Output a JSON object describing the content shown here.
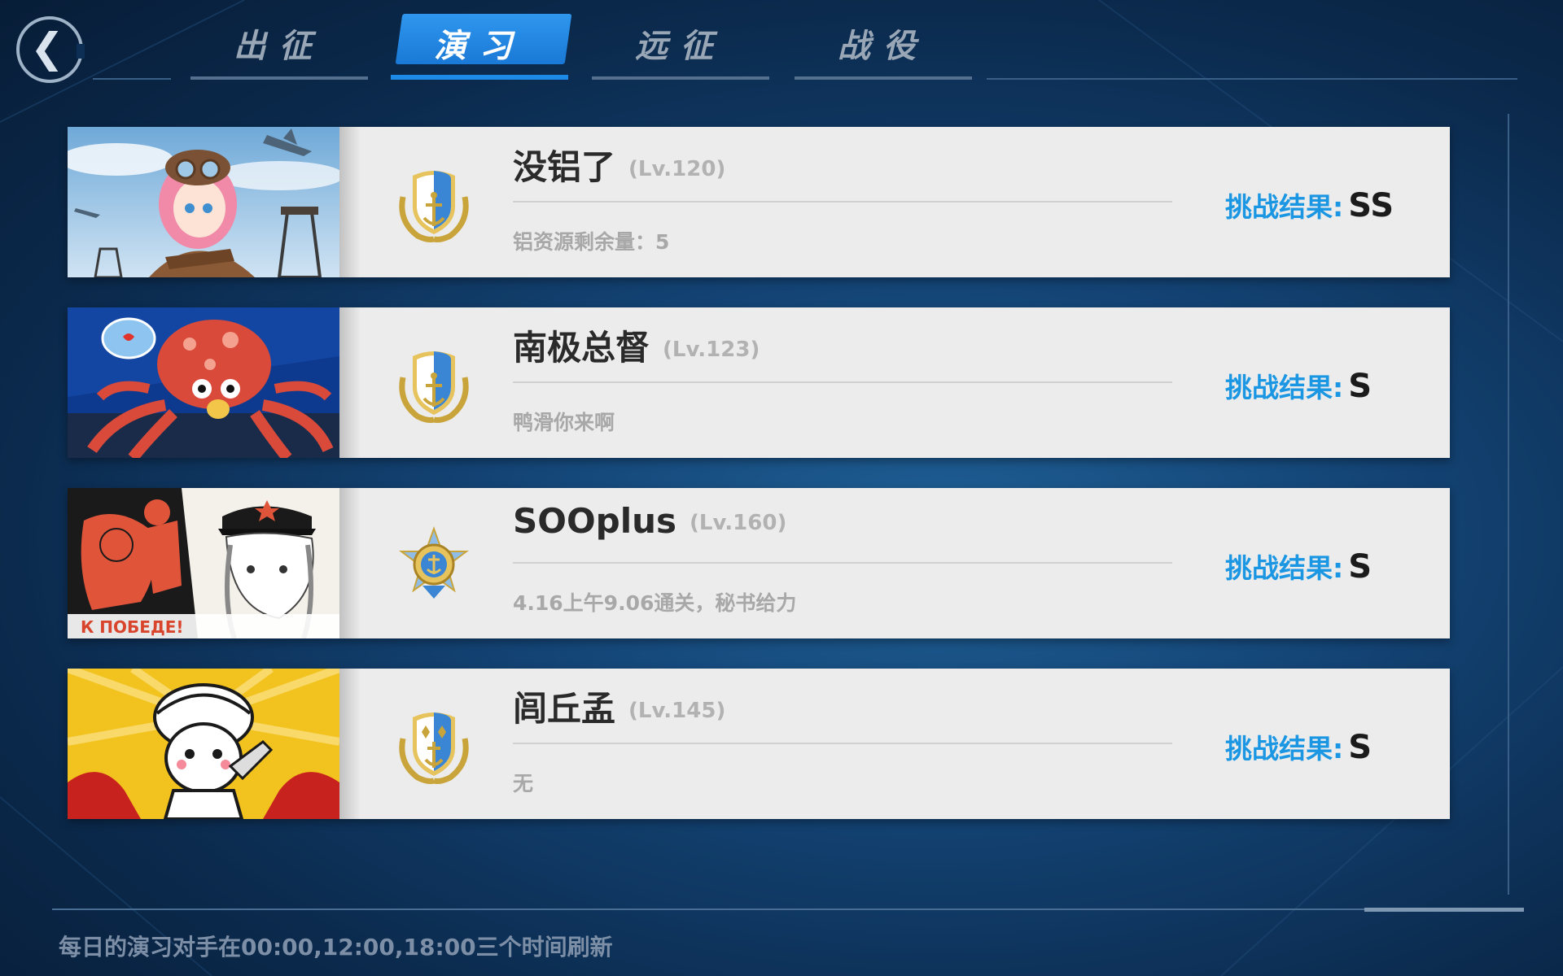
{
  "tabs": [
    {
      "label": "出征",
      "active": false
    },
    {
      "label": "演习",
      "active": true
    },
    {
      "label": "远征",
      "active": false
    },
    {
      "label": "战役",
      "active": false
    }
  ],
  "back_icon": "chevron-left-icon",
  "opponents": [
    {
      "name": "没铝了",
      "level": "(Lv.120)",
      "note": "铝资源剩余量：5",
      "result_label": "挑战结果:",
      "result_value": "SS",
      "badge": "anchor-shield-badge-icon"
    },
    {
      "name": "南极总督",
      "level": "(Lv.123)",
      "note": "鸭滑你来啊",
      "result_label": "挑战结果:",
      "result_value": "S",
      "badge": "anchor-shield-badge-icon"
    },
    {
      "name": "SOOplus",
      "level": "(Lv.160)",
      "note": "4.16上午9.06通关，秘书给力",
      "result_label": "挑战结果:",
      "result_value": "S",
      "badge": "star-medal-badge-icon"
    },
    {
      "name": "闾丘孟",
      "level": "(Lv.145)",
      "note": "无",
      "result_label": "挑战结果:",
      "result_value": "S",
      "badge": "diamond-anchor-shield-badge-icon"
    }
  ],
  "footer": {
    "refresh_text": "每日的演习对手在00:00,12:00,18:00三个时间刷新"
  },
  "colors": {
    "accent_blue": "#1a96e3",
    "active_tab": "#1e8ae8",
    "card_bg": "#ececec"
  }
}
